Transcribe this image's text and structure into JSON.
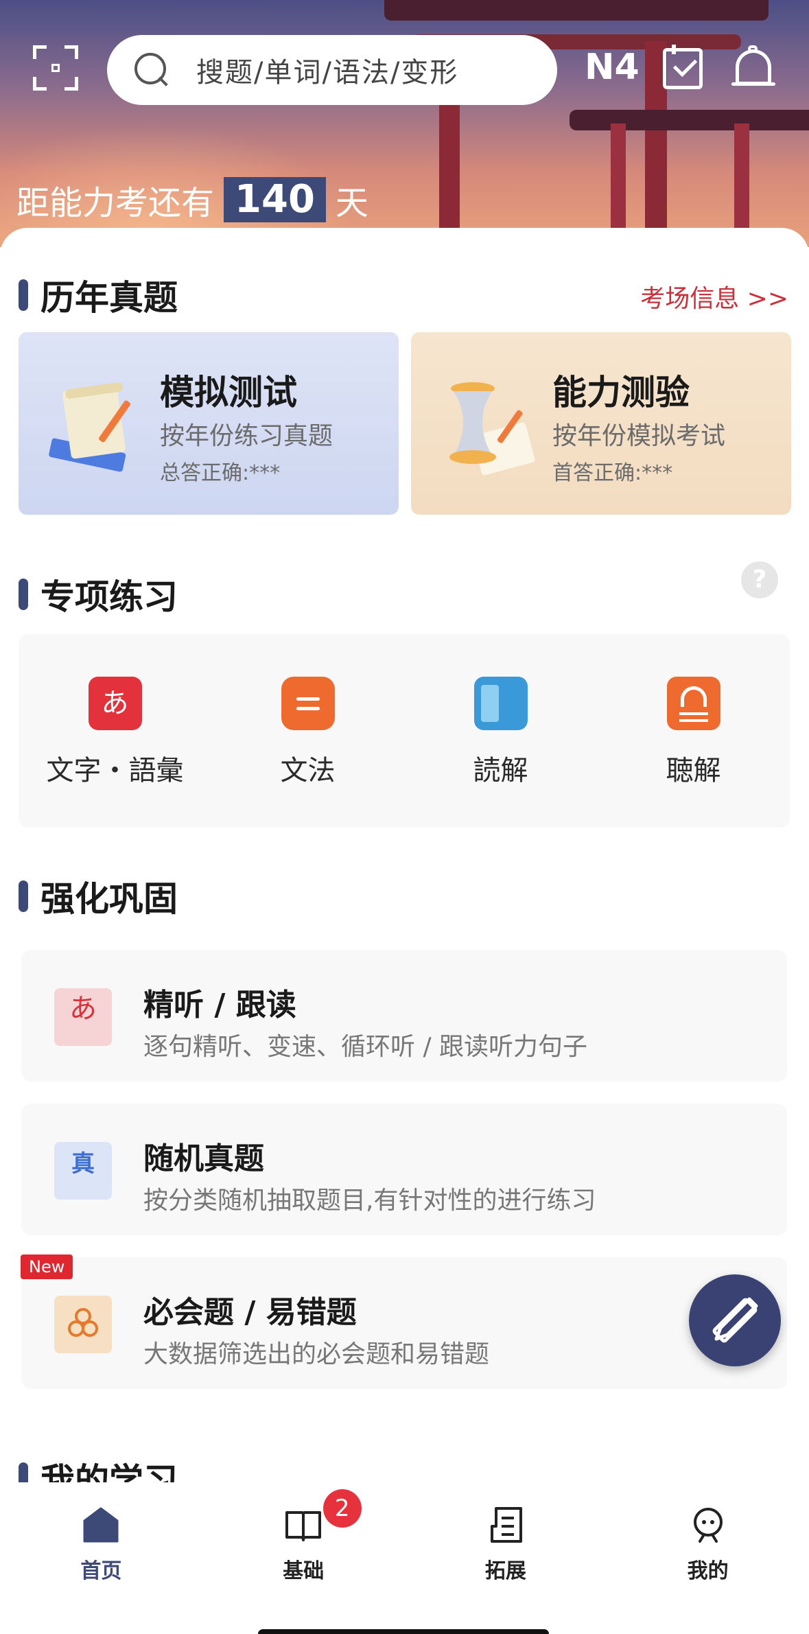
{
  "header": {
    "search_placeholder": "搜题/单词/语法/变形",
    "level": "N4",
    "countdown_prefix": "距能力考还有",
    "countdown_days": "140",
    "countdown_suffix": "天"
  },
  "past_exams": {
    "title": "历年真题",
    "link": "考场信息 >>",
    "cards": [
      {
        "title": "模拟测试",
        "subtitle": "按年份练习真题",
        "stat": "总答正确:***"
      },
      {
        "title": "能力测验",
        "subtitle": "按年份模拟考试",
        "stat": "首答正确:***"
      }
    ]
  },
  "special": {
    "title": "专项练习",
    "help": "?",
    "items": [
      {
        "label": "文字・語彙",
        "glyph": "あ",
        "color": "#e3323b"
      },
      {
        "label": "文法",
        "glyph": "",
        "color": "#ef6a2f"
      },
      {
        "label": "読解",
        "glyph": "",
        "color": "#3a9ad9"
      },
      {
        "label": "聴解",
        "glyph": "",
        "color": "#ee6a2f"
      }
    ]
  },
  "reinforce": {
    "title": "强化巩固",
    "items": [
      {
        "title": "精听 / 跟读",
        "subtitle": "逐句精听、变速、循环听 / 跟读听力句子",
        "glyph": "あ"
      },
      {
        "title": "随机真题",
        "subtitle": "按分类随机抽取题目,有针对性的进行练习",
        "glyph": "真"
      },
      {
        "title": "必会题 / 易错题",
        "subtitle": "大数据筛选出的必会题和易错题",
        "badge": "New"
      }
    ]
  },
  "my_study": {
    "title": "我的学习"
  },
  "nav": {
    "tabs": [
      {
        "label": "首页"
      },
      {
        "label": "基础",
        "badge": "2"
      },
      {
        "label": "拓展"
      },
      {
        "label": "我的"
      }
    ]
  },
  "colors": {
    "accent": "#3d4a78",
    "red": "#c8303a"
  }
}
